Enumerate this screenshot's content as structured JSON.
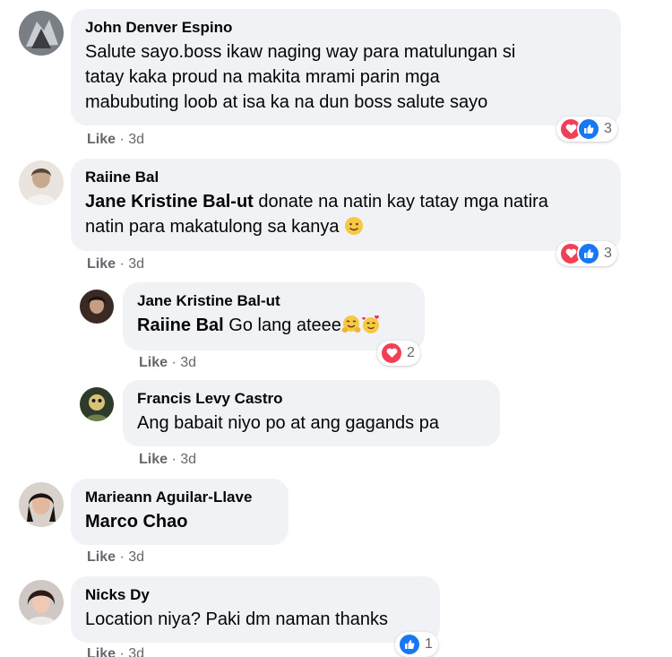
{
  "comments": [
    {
      "author": "John Denver Espino",
      "lines": [
        "Salute sayo.boss ikaw naging way para matulungan si",
        "tatay kaka proud na makita mrami parin mga",
        "mabubuting loob at isa ka na dun boss salute sayo"
      ],
      "like_label": "Like",
      "time": "3d",
      "reaction_count": "3"
    },
    {
      "author": "Raiine Bal",
      "mention": "Jane Kristine Bal-ut",
      "lines": [
        " donate na natin kay tatay mga natira",
        "natin para makatulong sa kanya "
      ],
      "emoji": "slightly-smiling-face-emoji",
      "like_label": "Like",
      "time": "3d",
      "reaction_count": "3"
    },
    {
      "author": "Jane Kristine Bal-ut",
      "mention": "Raiine Bal",
      "text": " Go lang ateee",
      "emojis": [
        "hugging-face-emoji",
        "smiling-face-with-hearts-emoji"
      ],
      "like_label": "Like",
      "time": "3d",
      "reaction_count": "2"
    },
    {
      "author": "Francis Levy Castro",
      "text": "Ang babait niyo po at ang gagands pa",
      "like_label": "Like",
      "time": "3d"
    },
    {
      "author": "Marieann Aguilar-Llave",
      "mention": "Marco Chao",
      "like_label": "Like",
      "time": "3d"
    },
    {
      "author": "Nicks Dy",
      "text": "Location niya? Paki dm naman thanks",
      "like_label": "Like",
      "time": "3d",
      "reaction_count": "1"
    }
  ],
  "meta_separator": "·",
  "colors": {
    "bubble": "#f0f2f5",
    "meta_text": "#65676b",
    "love": "#f33e58",
    "like": "#1877f2"
  }
}
